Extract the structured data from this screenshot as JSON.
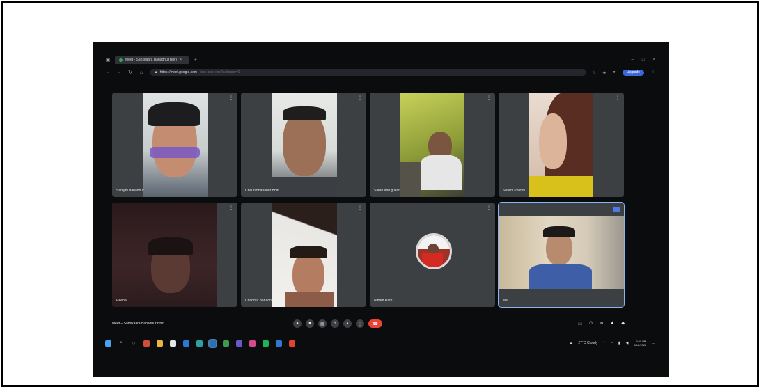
{
  "browser": {
    "tab_title": "Meet - Sanskaara Bahadhur Bhiri",
    "address_host": "https://meet.google.com",
    "address_rest": "/xxx-xxxx-xxx?authuser=0",
    "profile_label": "Upgrade"
  },
  "participants": [
    {
      "name": "Sarojini Bahadhur"
    },
    {
      "name": "Cheurimbahadur Bhiri"
    },
    {
      "name": "Sarah and guest"
    },
    {
      "name": "Shalini Phuritu"
    },
    {
      "name": "Reena"
    },
    {
      "name": "Chandra Bahadhur"
    },
    {
      "name": "Niham Rath"
    },
    {
      "name": "Me"
    }
  ],
  "meeting": {
    "title": "Meet – Sanskaara Bahadhur Bhiri"
  },
  "taskbar": {
    "weather": "27°C Cloudy",
    "time": "9:00 PM",
    "date": "6/12/2021"
  },
  "colors": {
    "background": "#0b0c0e",
    "tile": "#3c4043",
    "leave": "#ea4335",
    "accent": "#8ab4f8"
  }
}
